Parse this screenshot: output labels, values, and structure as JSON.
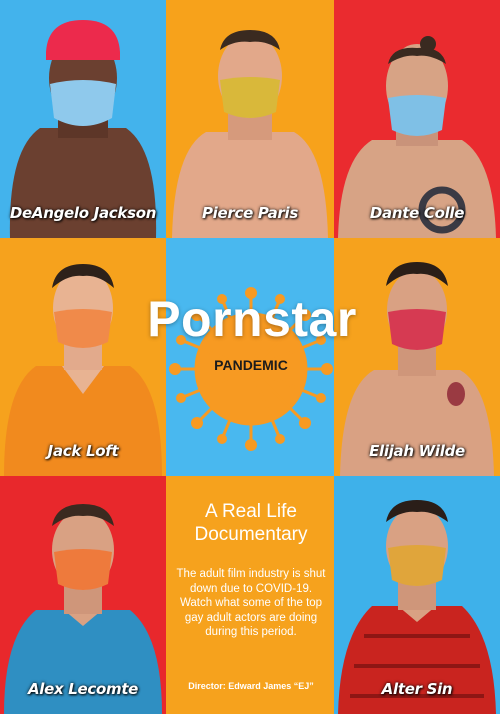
{
  "poster": {
    "title": "Pornstar",
    "subtitle": "PANDEMIC",
    "tagline": "A Real Life Documentary",
    "description": "The adult film industry is shut down due to COVID-19. Watch what some of the top gay adult actors are doing during this period.",
    "director": "Director: Edward James “EJ”"
  },
  "actors": [
    {
      "name": "DeAngelo Jackson",
      "bg": "#43b3ec",
      "mask": "#8fc9ec"
    },
    {
      "name": "Pierce Paris",
      "bg": "#f7a21b",
      "mask": "#d9b83a"
    },
    {
      "name": "Dante Colle",
      "bg": "#ea2b2f",
      "mask": "#7fc0e6"
    },
    {
      "name": "Jack Loft",
      "bg": "#f6a21d",
      "mask": "#f08a4a"
    },
    {
      "name": "Elijah Wilde",
      "bg": "#f6a21d",
      "mask": "#d63a52"
    },
    {
      "name": "Alex Lecomte",
      "bg": "#e8282c",
      "mask": "#ee7a3c"
    },
    {
      "name": "Alter Sin",
      "bg": "#3eb1ea",
      "mask": "#e0a53b"
    }
  ],
  "colors": {
    "sun_panel_bg": "#49b8ef",
    "sun": "#f79a22",
    "doc_panel_bg": "#f6a21d"
  }
}
